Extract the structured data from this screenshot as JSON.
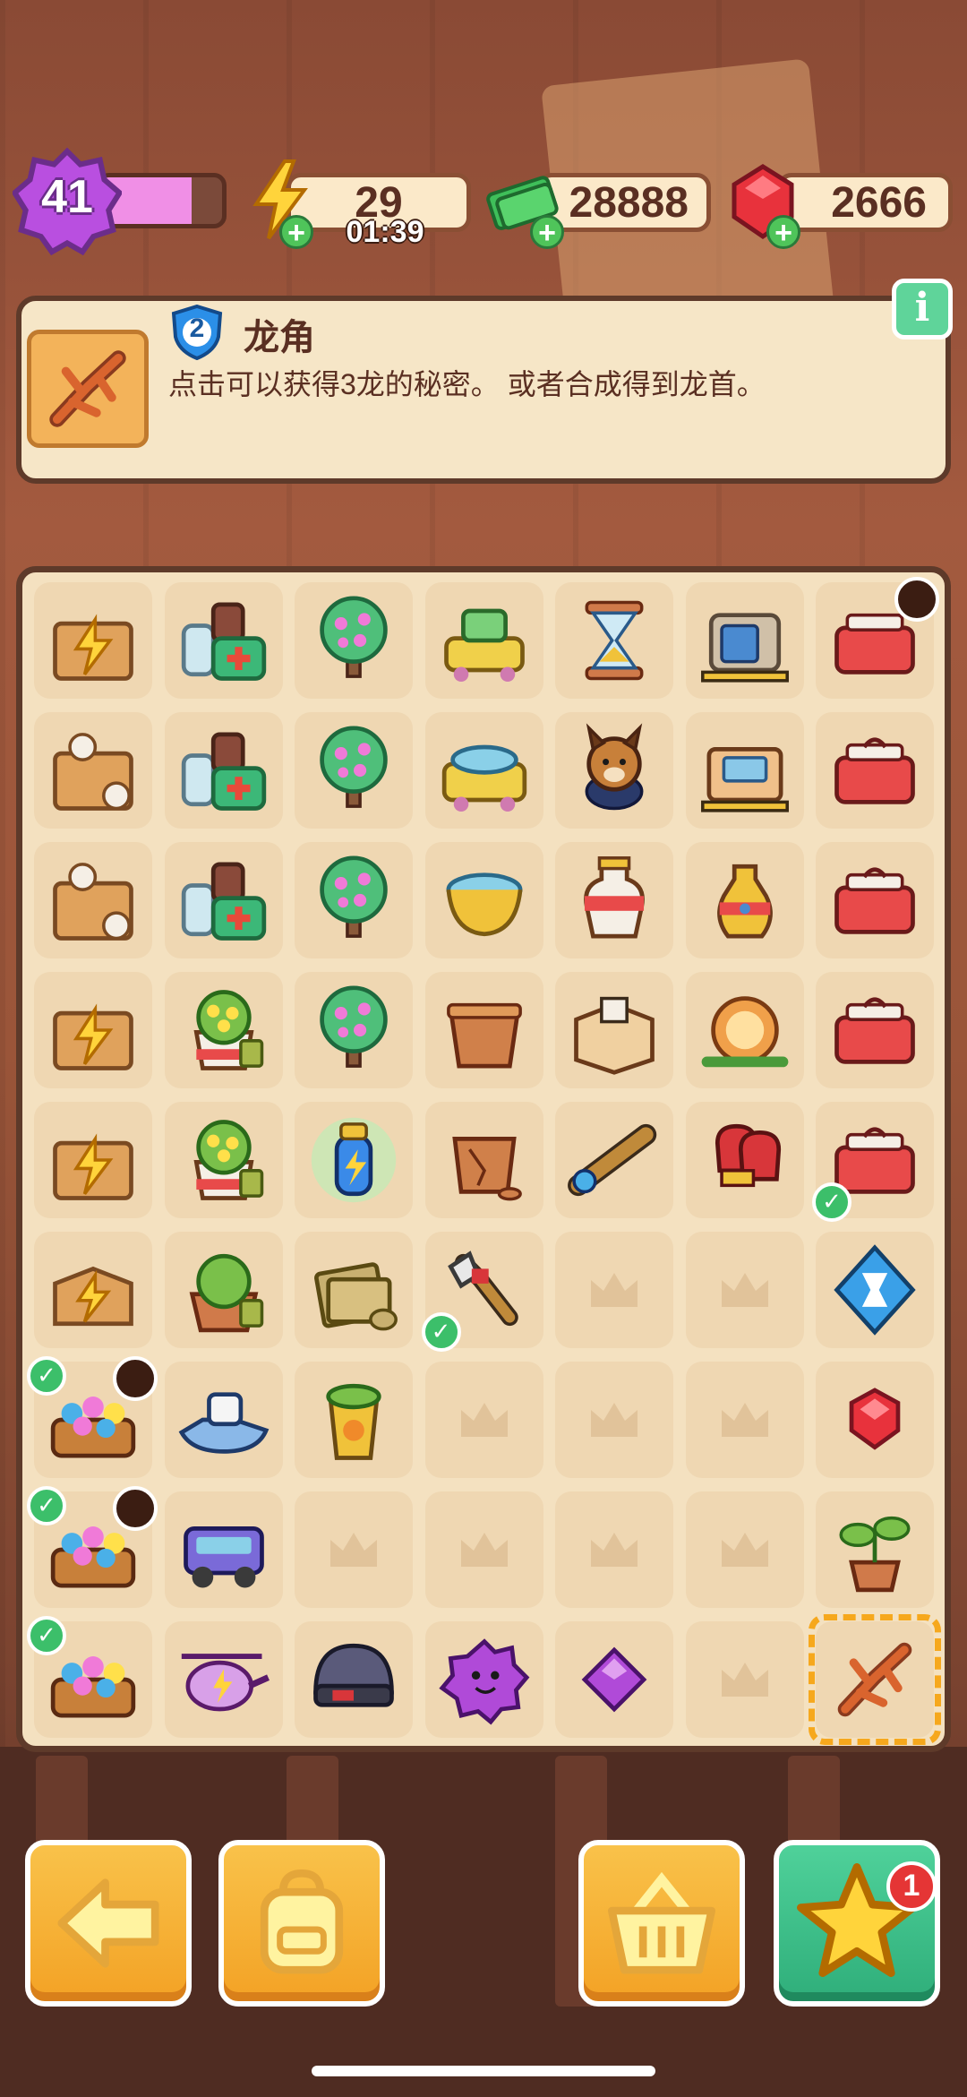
{
  "hud": {
    "level": "41",
    "level_progress": 0.75,
    "energy": "29",
    "energy_timer": "01:39",
    "cash": "28888",
    "gems": "2666"
  },
  "info": {
    "item_level": "2",
    "item_name": "龙角",
    "description": "点击可以获得3龙的秘密。 或者合成得到龙首。",
    "info_button": "i"
  },
  "board": {
    "selected": "dragon-horn",
    "rows": [
      [
        "energy-crate",
        "medical-kit",
        "blossom-tree",
        "cart-machine",
        "hourglass",
        "safe",
        "toolbox-timer"
      ],
      [
        "wooden-crate",
        "medical-kit",
        "blossom-tree",
        "fountain-cart",
        "shepherd-dog",
        "bank-counter",
        "toolbox"
      ],
      [
        "wooden-crate",
        "medical-kit",
        "blossom-tree",
        "fountain",
        "vase-tower",
        "vase",
        "toolbox"
      ],
      [
        "energy-crate",
        "flower-pot",
        "blossom-tree",
        "clay-pot",
        "cardboard-box",
        "magic-orb",
        "toolbox"
      ],
      [
        "energy-crate",
        "flower-pot",
        "energy-bottle",
        "broken-pot",
        "telescope",
        "boxing-gloves",
        "toolbox"
      ],
      [
        "energy-box",
        "plant-pot",
        "cloth-stack",
        "wrench",
        "empty",
        "empty",
        "hourglass-gem"
      ],
      [
        "flower-basket",
        "jet-ski",
        "juice-cup",
        "empty",
        "empty",
        "empty",
        "red-gem"
      ],
      [
        "flower-basket",
        "jeep",
        "empty",
        "empty",
        "empty",
        "empty",
        "sprout"
      ],
      [
        "flower-basket",
        "helicopter",
        "helmet",
        "purple-blob",
        "purple-gem",
        "empty",
        "dragon-horn"
      ]
    ]
  },
  "buttons": {
    "back": "back-arrow-icon",
    "backpack": "backpack-icon",
    "shop": "basket-icon",
    "tasks": "star-icon",
    "tasks_badge": "1"
  }
}
